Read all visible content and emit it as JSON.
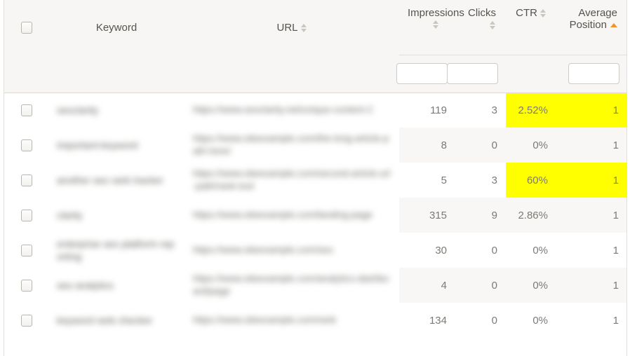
{
  "table": {
    "columns": [
      {
        "key": "select",
        "label": "",
        "sort": "none"
      },
      {
        "key": "keyword",
        "label": "Keyword",
        "sort": "none"
      },
      {
        "key": "url",
        "label": "URL",
        "sort": "sortable"
      },
      {
        "key": "impressions",
        "label": "Impressions",
        "sort": "sortable"
      },
      {
        "key": "clicks",
        "label": "Clicks",
        "sort": "sortable"
      },
      {
        "key": "ctr",
        "label": "CTR",
        "sort": "sortable"
      },
      {
        "key": "position_line1",
        "label": "Average",
        "sort": "asc"
      },
      {
        "key": "position_line2",
        "label": "Position",
        "sort": "asc"
      }
    ],
    "header": {
      "keyword_label": "Keyword",
      "url_label": "URL",
      "impressions_label": "Impressions",
      "clicks_label": "Clicks",
      "ctr_label": "CTR",
      "position_label_line1": "Average",
      "position_label_line2": "Position"
    },
    "filters": {
      "impressions": {
        "value": "",
        "placeholder": ""
      },
      "clicks": {
        "value": "",
        "placeholder": ""
      },
      "ctr": {
        "value": null,
        "placeholder": null
      },
      "position": {
        "value": "",
        "placeholder": ""
      }
    },
    "rows": [
      {
        "keyword": "seoclarity",
        "url": "https://www.seoclarity.net/unique-content-2",
        "impressions": "119",
        "clicks": "3",
        "ctr": "2.52%",
        "position": "1",
        "highlighted": true
      },
      {
        "keyword": "important-keyword",
        "url": "https://www.siteexample.com/the-long-article-path-here/",
        "impressions": "8",
        "clicks": "0",
        "ctr": "0%",
        "position": "1",
        "highlighted": false
      },
      {
        "keyword": "another seo rank tracker",
        "url": "https://www.siteexample.com/second-article-url-path/rank-tool",
        "impressions": "5",
        "clicks": "3",
        "ctr": "60%",
        "position": "1",
        "highlighted": true
      },
      {
        "keyword": "clarity",
        "url": "https://www.siteexample.com/landing-page",
        "impressions": "315",
        "clicks": "9",
        "ctr": "2.86%",
        "position": "1",
        "highlighted": false
      },
      {
        "keyword": "enterprise seo platform reporting",
        "url": "https://www.siteexample.com/seo",
        "impressions": "30",
        "clicks": "0",
        "ctr": "0%",
        "position": "1",
        "highlighted": false
      },
      {
        "keyword": "seo analytics",
        "url": "https://www.siteexample.com/analytics-dashboard/page",
        "impressions": "4",
        "clicks": "0",
        "ctr": "0%",
        "position": "1",
        "highlighted": false
      },
      {
        "keyword": "keyword rank checker",
        "url": "https://www.siteexample.com/rank",
        "impressions": "134",
        "clicks": "0",
        "ctr": "0%",
        "position": "1",
        "highlighted": false
      }
    ]
  },
  "colors": {
    "header_bg": "#f7f6f4",
    "row_alt_bg": "#f8f7f5",
    "row_bg": "#ffffff",
    "border": "#e2e0db",
    "text": "#7c7a75",
    "position_text": "#c8a96a",
    "highlight": "#ffff00",
    "sort_active": "#f0932b",
    "sort_inactive": "#c9c6c0"
  },
  "icons": {
    "sort_both": "sort-both-icon",
    "sort_asc": "sort-ascending-icon",
    "checkbox": "checkbox-icon"
  }
}
